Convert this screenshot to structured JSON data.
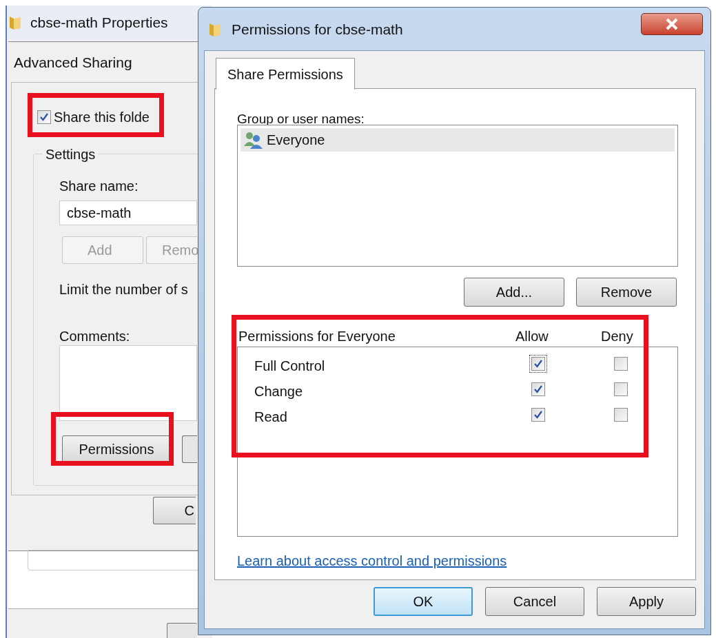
{
  "back_window": {
    "title": "cbse-math Properties",
    "dialog": {
      "title": "Advanced Sharing",
      "share_checkbox": {
        "label": "Share this folde",
        "checked": true
      },
      "settings_group": "Settings",
      "share_name_label": "Share name:",
      "share_name_value": "cbse-math",
      "buttons": [
        {
          "label": "Add",
          "disabled": true
        },
        {
          "label": "Remo",
          "disabled": true
        }
      ],
      "limit_label": "Limit the number of s",
      "comments_label": "Comments:",
      "permissions_button": "Permissions",
      "ok_button": "C"
    }
  },
  "front_window": {
    "title": "Permissions for cbse-math",
    "tabs": [
      {
        "label": "Share Permissions",
        "selected": true
      }
    ],
    "group_label": "Group or user names:",
    "users": [
      {
        "name": "Everyone",
        "selected": true
      }
    ],
    "user_buttons": [
      "Add...",
      "Remove"
    ],
    "permissions": {
      "title": "Permissions for Everyone",
      "columns": [
        "Allow",
        "Deny"
      ],
      "rows": [
        {
          "name": "Full Control",
          "allow": true,
          "deny": false
        },
        {
          "name": "Change",
          "allow": true,
          "deny": false
        },
        {
          "name": "Read",
          "allow": true,
          "deny": false
        }
      ]
    },
    "link": "Learn about access control and permissions",
    "buttons": [
      {
        "label": "OK",
        "default": true
      },
      {
        "label": "Cancel",
        "default": false
      },
      {
        "label": "Apply",
        "default": false
      }
    ]
  }
}
